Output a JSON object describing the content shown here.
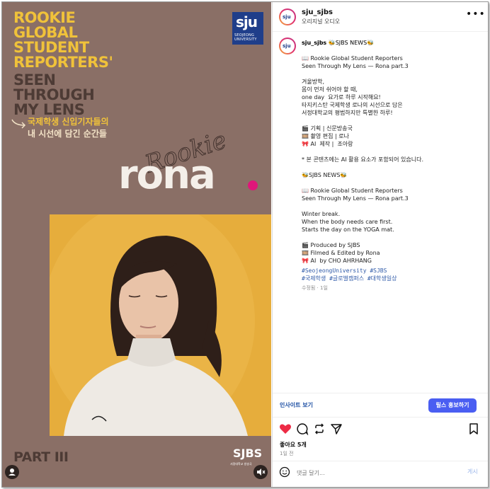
{
  "media": {
    "title_yellow": "ROOKIE\nGLOBAL\nSTUDENT\nREPORTERS'",
    "title_brown": "SEEN\nTHROUGH\nMY LENS",
    "korean_line1": "국제학생 신입기자들의",
    "korean_line2": "내 시선에 담긴 순간들",
    "logo_mark": "sju",
    "logo_sub": "SEOJEONG\nUNIVERSITY",
    "rookie_script": "Rookie",
    "rona": "rona",
    "part": "PART III",
    "sjbs": "SJBS",
    "sjbs_sub": "서정대학교 방송국",
    "colors": {
      "background": "#8a6f66",
      "title": "#f0c23a",
      "photo_bg": "#e6ad3c",
      "dot": "#e0167a"
    }
  },
  "header": {
    "username": "sju_sjbs",
    "subtitle": "오리지널 오디오",
    "more_icon": "more-horizontal-icon"
  },
  "caption": {
    "username": "sju_sjbs",
    "headline": " 🐝SJBS NEWS🐝",
    "body": "📖 Rookie Global Student Reporters\nSeen Through My Lens — Rona part.3\n\n겨울방학,\n몸이 먼저 쉬어야 할 때,\none day  요가로 하루 시작해요!\n타지키스탄 국제학생 로나의 시선으로 담은\n서정대학교의 평범하지만 특별한 하루!\n\n🎬 기획 | 신문방송국\n🎞️ 촬영 편집 | 로나\n🎀 AI  제작 |  조아랑\n\n* 본 콘텐츠에는 AI 활용 요소가 포함되어 있습니다.\n\n🐝SJBS NEWS🐝\n\n📖 Rookie Global Student Reporters\nSeen Through My Lens — Rona part.3\n\nWinter break.\nWhen the body needs care first.\nStarts the day on the YOGA mat.\n\n🎬 Produced by SJBS\n🎞️ Filmed & Edited by Rona\n🎀 AI  by CHO AHRHANG",
    "hashtags": "#SeojeongUniversity #SJBS\n#국제학생 #글로벌캠퍼스 #대학생일상",
    "edited": "수정됨 · 1일"
  },
  "actions": {
    "insight": "인사이트 보기",
    "promote": "릴스 홍보하기",
    "icons": [
      "heart-icon",
      "comment-icon",
      "repost-icon",
      "share-icon",
      "bookmark-icon"
    ],
    "likes": "좋아요 5개",
    "time": "1일 전"
  },
  "comment": {
    "placeholder": "댓글 달기...",
    "post": "게시"
  }
}
